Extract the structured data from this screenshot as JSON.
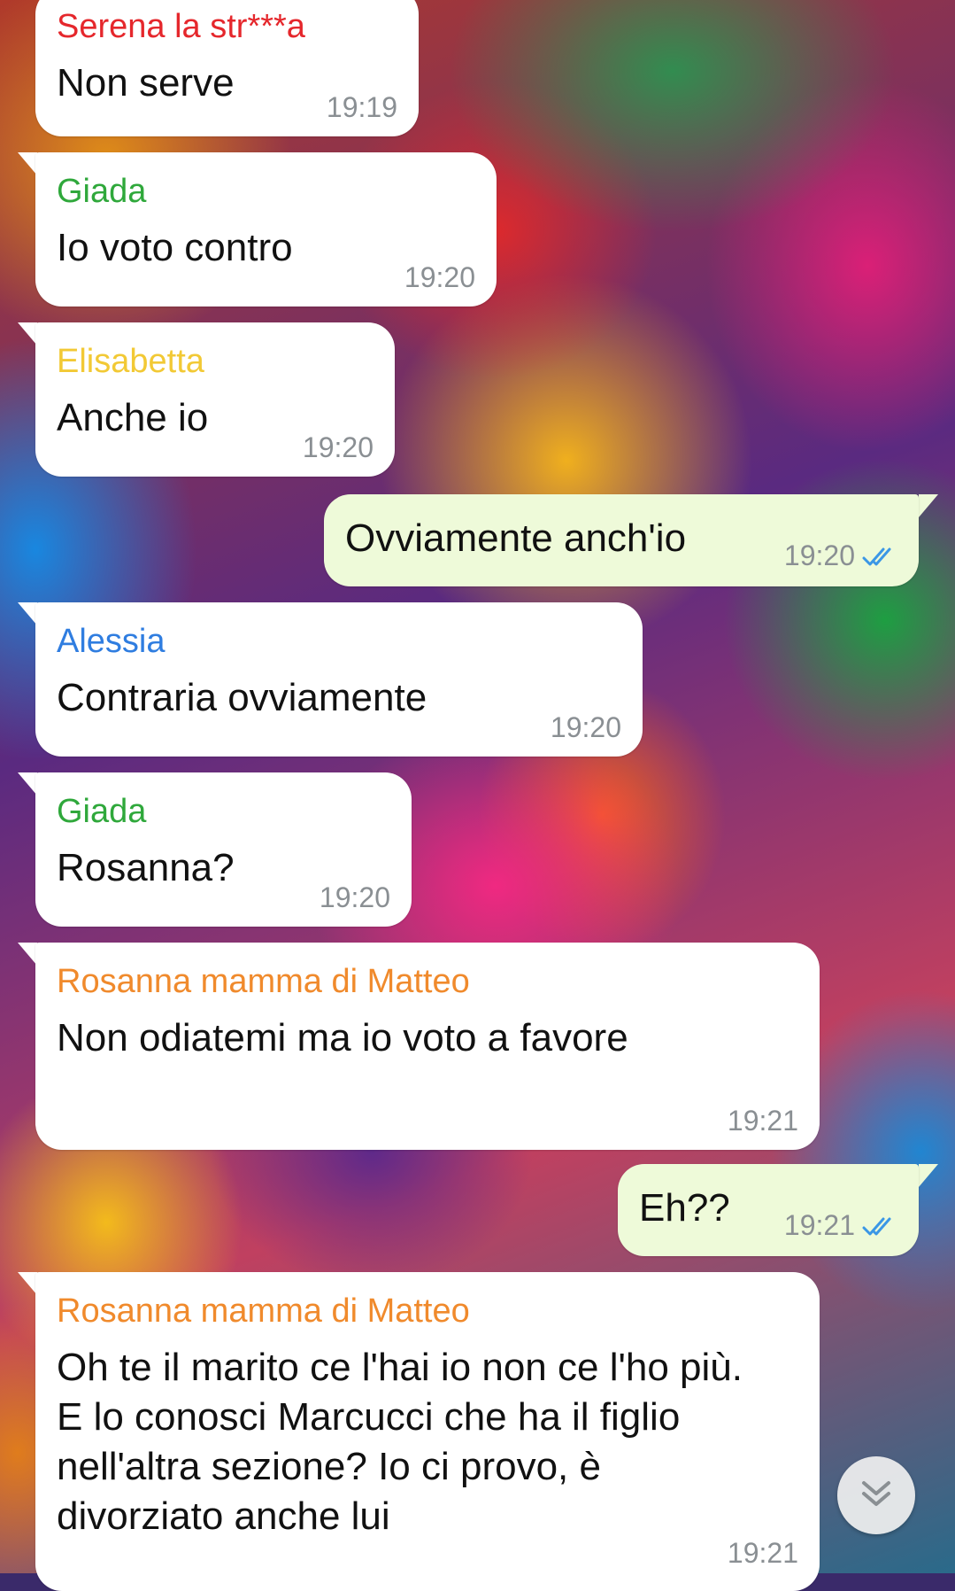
{
  "colors": {
    "incoming_bubble": "#ffffff",
    "outgoing_bubble": "#eefad9",
    "timestamp": "#8a8f93",
    "read_ticks": "#3b97e6"
  },
  "messages": [
    {
      "direction": "in",
      "sender": "Serena la str***a",
      "sender_color": "#e5272c",
      "text": "Non serve",
      "time": "19:19"
    },
    {
      "direction": "in",
      "sender": "Giada",
      "sender_color": "#2fa83b",
      "text": "Io voto contro",
      "time": "19:20"
    },
    {
      "direction": "in",
      "sender": "Elisabetta",
      "sender_color": "#f2c935",
      "text": "Anche io",
      "time": "19:20"
    },
    {
      "direction": "out",
      "text": "Ovviamente anch'io",
      "time": "19:20",
      "status_icon": "double-check-read-icon"
    },
    {
      "direction": "in",
      "sender": "Alessia",
      "sender_color": "#2f7de0",
      "text": "Contraria ovviamente",
      "time": "19:20"
    },
    {
      "direction": "in",
      "sender": "Giada",
      "sender_color": "#2fa83b",
      "text": "Rosanna?",
      "time": "19:20"
    },
    {
      "direction": "in",
      "sender": "Rosanna mamma di Matteo",
      "sender_color": "#f08a2c",
      "text": "Non odiatemi ma io voto a favore",
      "time": "19:21"
    },
    {
      "direction": "out",
      "text": "Eh??",
      "time": "19:21",
      "status_icon": "double-check-read-icon"
    },
    {
      "direction": "in",
      "sender": "Rosanna mamma di Matteo",
      "sender_color": "#f08a2c",
      "text": "Oh te il marito ce l'hai io non ce l'ho più. E lo conosci Marcucci che ha il figlio nell'altra sezione? Io ci provo, è divorziato anche lui",
      "time": "19:21"
    }
  ],
  "scroll_button": {
    "icon": "double-chevron-down-icon"
  }
}
